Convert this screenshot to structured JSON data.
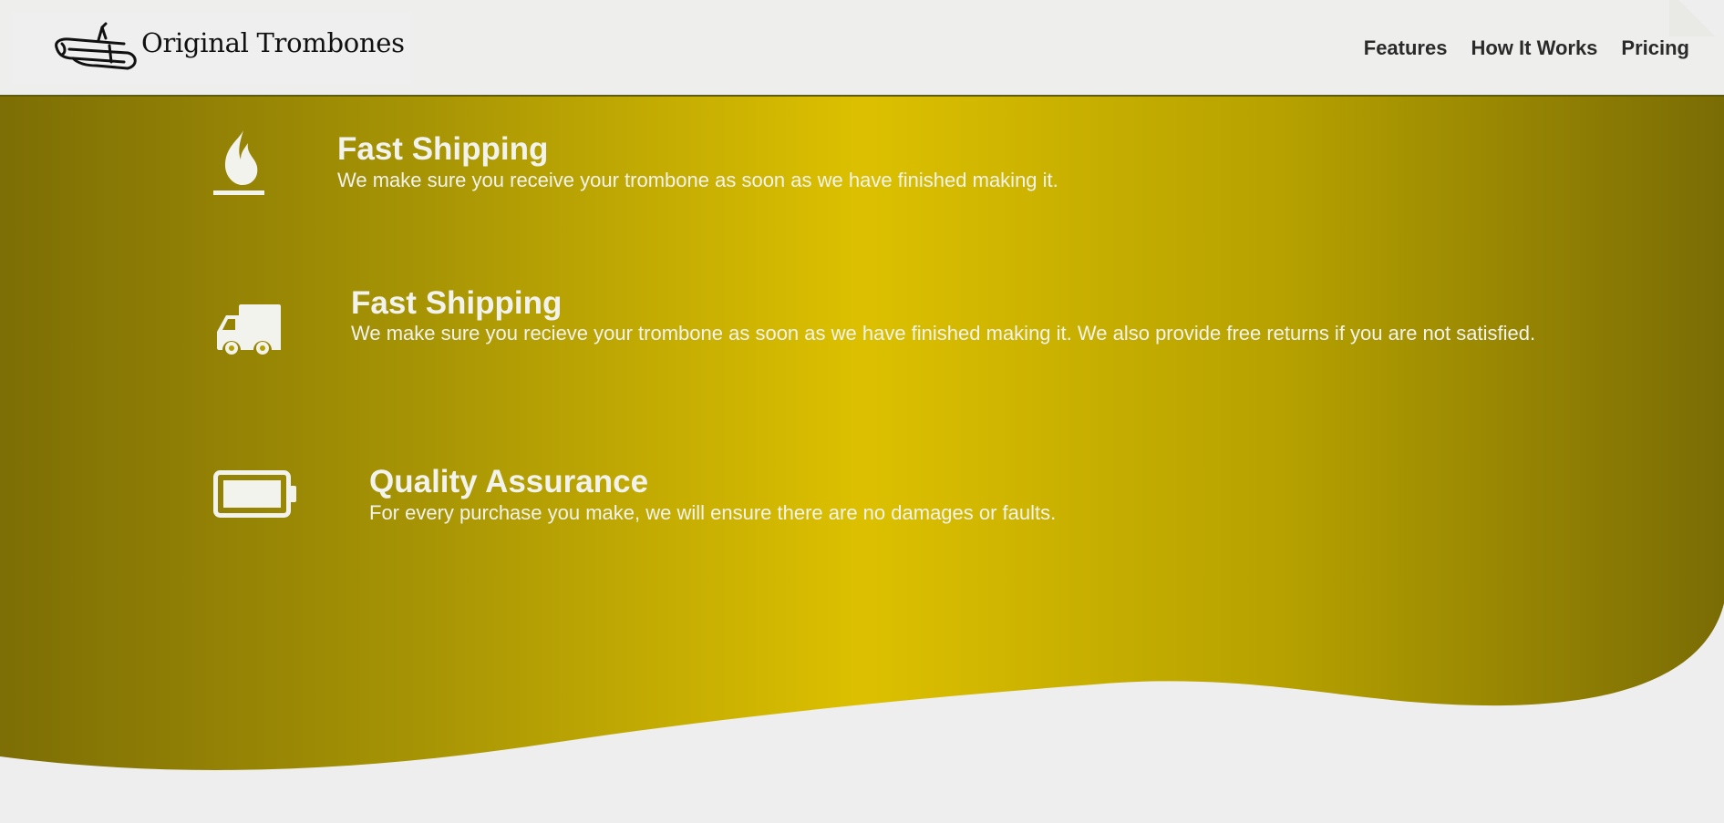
{
  "brand": {
    "title": "Original Trombones",
    "logo_icon": "trombone-icon"
  },
  "nav": {
    "items": [
      {
        "label": "Features"
      },
      {
        "label": "How It Works"
      },
      {
        "label": "Pricing"
      }
    ]
  },
  "colors": {
    "band_dark": "#7d6e05",
    "band_light": "#dcc000",
    "text_light": "#f3f3ee",
    "page_bg": "#eeeeee"
  },
  "features": [
    {
      "icon": "fire-icon",
      "title": "Fast Shipping",
      "description": "We make sure you receive your trombone as soon as we have finished making it."
    },
    {
      "icon": "truck-icon",
      "title": "Fast Shipping",
      "description": "We make sure you recieve your trombone as soon as we have finished making it. We also provide free returns if you are not satisfied."
    },
    {
      "icon": "battery-icon",
      "title": "Quality Assurance",
      "description": "For every purchase you make, we will ensure there are no damages or faults."
    }
  ]
}
